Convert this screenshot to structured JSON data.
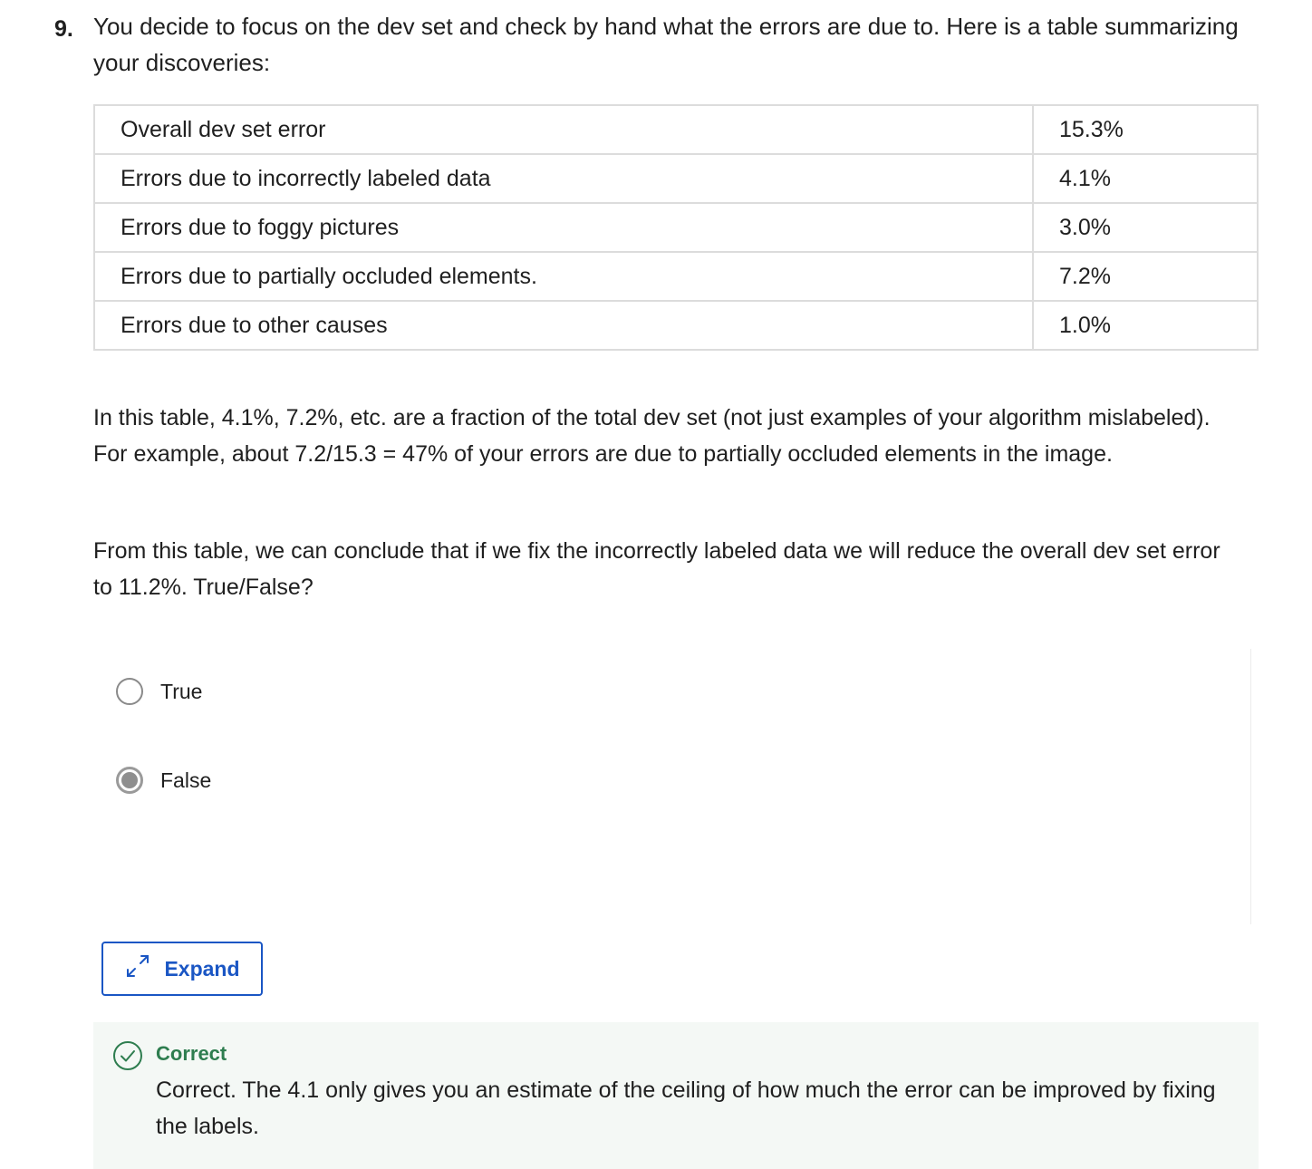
{
  "question": {
    "number": "9.",
    "text": "You decide to focus on the dev set and check by hand what the errors are due to. Here is a table summarizing your discoveries:"
  },
  "table": {
    "rows": [
      {
        "label": "Overall dev set error",
        "value": "15.3%"
      },
      {
        "label": "Errors due to incorrectly labeled data",
        "value": "4.1%"
      },
      {
        "label": "Errors due to foggy pictures",
        "value": "3.0%"
      },
      {
        "label": "Errors due to partially occluded elements.",
        "value": "7.2%"
      },
      {
        "label": "Errors due to other causes",
        "value": "1.0%"
      }
    ]
  },
  "explanation": "In this table, 4.1%, 7.2%, etc. are a fraction of the total dev set (not just examples of your algorithm mislabeled). For example, about 7.2/15.3 = 47% of your errors are due to partially occluded elements in the image.",
  "prompt": "From this table, we can conclude that if we fix the incorrectly labeled data we will reduce the overall dev set error to 11.2%. True/False?",
  "options": [
    {
      "label": "True",
      "selected": false
    },
    {
      "label": "False",
      "selected": true
    }
  ],
  "expand_button": {
    "label": "Expand",
    "icon": "expand-arrows-icon"
  },
  "feedback": {
    "status": "Correct",
    "text": "Correct. The 4.1 only gives you an estimate of the ceiling of how much the error can be improved by fixing the labels.",
    "icon": "check-circle-icon",
    "color": "#2e7d4f"
  },
  "colors": {
    "accent": "#1a56c4",
    "feedback_bg": "#f4f8f5"
  }
}
